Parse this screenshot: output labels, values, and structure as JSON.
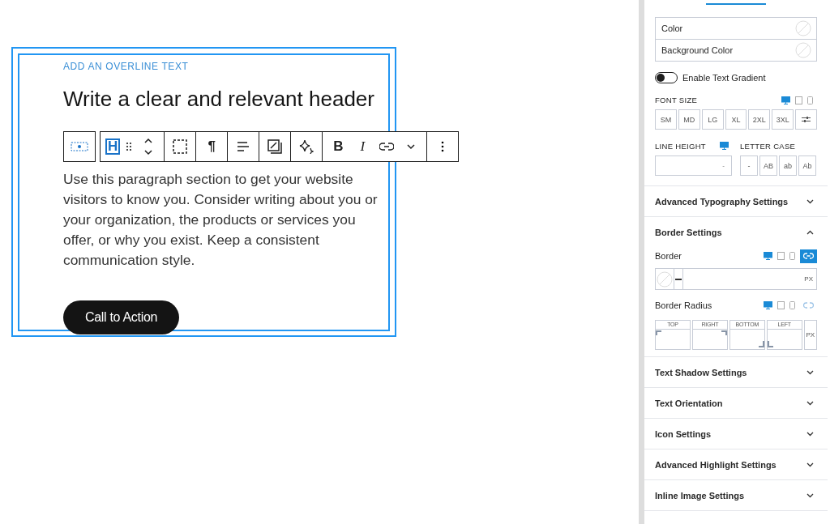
{
  "block": {
    "overline": "ADD AN OVERLINE TEXT",
    "heading": "Write a clear and relevant header",
    "paragraph": "Use this paragraph section to get your website visitors to know you. Consider writing about you or your organization, the products or services you offer, or why you exist. Keep a consistent communication style.",
    "cta": "Call to Action"
  },
  "toolbar": [
    [
      {
        "kind": "block"
      }
    ],
    [
      {
        "kind": "heading",
        "text": "H",
        "selected": true
      },
      {
        "kind": "drag"
      },
      {
        "kind": "move"
      }
    ],
    [
      {
        "kind": "select"
      }
    ],
    [
      {
        "kind": "char",
        "text": "¶"
      }
    ],
    [
      {
        "kind": "align"
      }
    ],
    [
      {
        "kind": "image"
      }
    ],
    [
      {
        "kind": "sparkle"
      }
    ],
    [
      {
        "kind": "bold",
        "text": "B"
      },
      {
        "kind": "italic",
        "text": "I"
      },
      {
        "kind": "link"
      },
      {
        "kind": "chevron"
      }
    ],
    [
      {
        "kind": "more"
      }
    ]
  ],
  "sidebar": {
    "colors": [
      {
        "label": "Color"
      },
      {
        "label": "Background Color"
      }
    ],
    "gradient": {
      "label": "Enable Text Gradient",
      "on": false
    },
    "font_size": {
      "label": "FONT SIZE",
      "devices": [
        {
          "kind": "desktop",
          "selected": true
        },
        {
          "kind": "tablet",
          "selected": false
        },
        {
          "kind": "mobile",
          "selected": false
        }
      ],
      "options": [
        {
          "kind": "text",
          "text": "SM"
        },
        {
          "kind": "text",
          "text": "MD"
        },
        {
          "kind": "text",
          "text": "LG"
        },
        {
          "kind": "text",
          "text": "XL"
        },
        {
          "kind": "text",
          "text": "2XL"
        },
        {
          "kind": "text",
          "text": "3XL"
        },
        {
          "kind": "custom"
        }
      ]
    },
    "line_height": {
      "label": "LINE HEIGHT",
      "unit": "-"
    },
    "letter_case": {
      "label": "LETTER CASE",
      "options": [
        "-",
        "AB",
        "ab",
        "Ab"
      ]
    },
    "sections": [
      {
        "title": "Advanced Typography Settings",
        "expanded": false
      },
      {
        "title": "Border Settings",
        "expanded": true
      },
      {
        "title": "Text Shadow Settings",
        "expanded": false
      },
      {
        "title": "Text Orientation",
        "expanded": false
      },
      {
        "title": "Icon Settings",
        "expanded": false
      },
      {
        "title": "Advanced Highlight Settings",
        "expanded": false
      },
      {
        "title": "Inline Image Settings",
        "expanded": false
      }
    ],
    "border": {
      "label": "Border",
      "linked": true,
      "unit": "PX"
    },
    "border_radius": {
      "label": "Border Radius",
      "linked": false,
      "sides": [
        "TOP",
        "RIGHT",
        "BOTTOM",
        "LEFT"
      ],
      "unit": "PX"
    }
  }
}
